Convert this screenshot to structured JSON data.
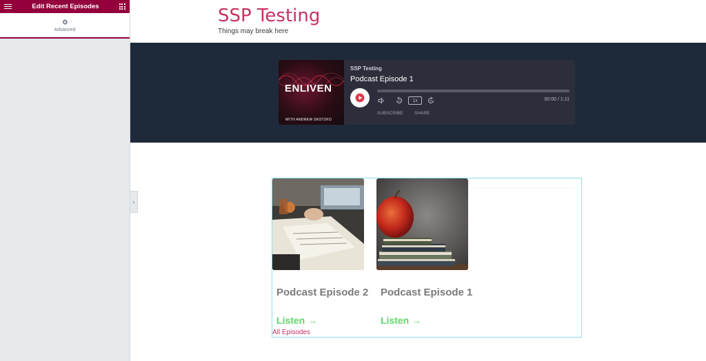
{
  "sidebar": {
    "title": "Edit Recent Episodes",
    "tab_label": "Advanced",
    "icons": {
      "menu": "hamburger-icon",
      "apps": "grid-icon",
      "settings": "gear-icon",
      "collapse": "chevron-left-icon"
    },
    "collapse_glyph": "‹"
  },
  "site": {
    "title": "SSP Testing",
    "tagline": "Things may break here"
  },
  "player": {
    "cover_title": "ENLIVEN",
    "cover_subtitle": "WITH ANDREW SKOTZKO",
    "show_name": "SSP Testing",
    "episode_title": "Podcast Episode 1",
    "speed": "1x",
    "time": "00:00 / 1:11",
    "progress": 0,
    "subscribe_label": "SUBSCRIBE",
    "share_label": "SHARE",
    "icons": {
      "play": "play-icon",
      "volume": "volume-icon",
      "rewind": "rewind-10-icon",
      "forward": "forward-30-icon"
    }
  },
  "episodes": {
    "items": [
      {
        "title": "Podcast Episode 2",
        "listen_label": "Listen →",
        "image": "desk-notebook-photo"
      },
      {
        "title": "Podcast Episode 1",
        "listen_label": "Listen →",
        "image": "apple-books-photo"
      }
    ],
    "all_episodes_label": "All Episodes"
  },
  "colors": {
    "editor_accent": "#93003c",
    "site_title": "#c7325f",
    "band": "#1e2a3a",
    "listen": "#5dd66c",
    "widget_outline": "#8fdcea"
  }
}
